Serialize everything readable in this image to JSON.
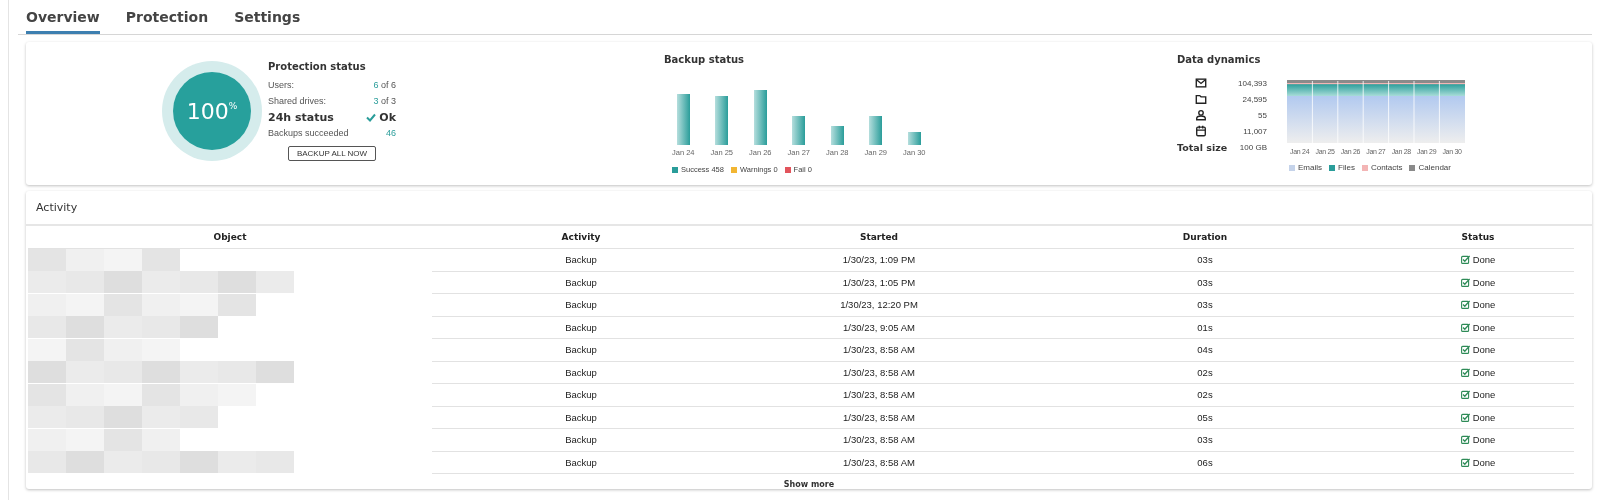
{
  "tabs": [
    {
      "label": "Overview",
      "selected": true
    },
    {
      "label": "Protection",
      "selected": false
    },
    {
      "label": "Settings",
      "selected": false
    }
  ],
  "protection": {
    "title": "Protection status",
    "percent": "100",
    "percent_sign": "%",
    "rows": [
      {
        "kind": "ratio",
        "label": "Users:",
        "value": "6",
        "suffix": "of 6"
      },
      {
        "kind": "ratio",
        "label": "Shared drives:",
        "value": "3",
        "suffix": "of 3"
      },
      {
        "kind": "status",
        "label": "24h status",
        "value": "Ok"
      },
      {
        "kind": "count",
        "label": "Backups succeeded",
        "value": "46"
      }
    ],
    "button": "BACKUP ALL NOW"
  },
  "backup_status": {
    "title": "Backup status",
    "x_labels": [
      "Jan 24",
      "Jan 25",
      "Jan 26",
      "Jan 27",
      "Jan 28",
      "Jan 29",
      "Jan 30"
    ],
    "legend": [
      {
        "label": "Success 458",
        "color": "#2a9d9a"
      },
      {
        "label": "Warnings 0",
        "color": "#f2b632"
      },
      {
        "label": "Fail 0",
        "color": "#e2545c"
      }
    ]
  },
  "data_dynamics": {
    "title": "Data dynamics",
    "counts": [
      {
        "kind": "email",
        "value": "104,393"
      },
      {
        "kind": "folder",
        "value": "24,595"
      },
      {
        "kind": "person",
        "value": "55"
      },
      {
        "kind": "calendar",
        "value": "11,007"
      }
    ],
    "total": {
      "label": "Total size",
      "value": "100 GB"
    },
    "x_labels": [
      "Jan 24",
      "Jan 25",
      "Jan 26",
      "Jan 27",
      "Jan 28",
      "Jan 29",
      "Jan 30"
    ],
    "legend": [
      {
        "label": "Emails",
        "color": "#c5d3ea"
      },
      {
        "label": "Files",
        "color": "#2a9d9a"
      },
      {
        "label": "Contacts",
        "color": "#f3b5b5"
      },
      {
        "label": "Calendar",
        "color": "#8a8a8a"
      }
    ]
  },
  "activity": {
    "title": "Activity",
    "columns": [
      "Object",
      "Activity",
      "Started",
      "Duration",
      "Status"
    ],
    "rows": [
      {
        "activity": "Backup",
        "started": "1/30/23, 1:09 PM",
        "duration": "03s",
        "status": "Done"
      },
      {
        "activity": "Backup",
        "started": "1/30/23, 1:05 PM",
        "duration": "03s",
        "status": "Done"
      },
      {
        "activity": "Backup",
        "started": "1/30/23, 12:20 PM",
        "duration": "03s",
        "status": "Done"
      },
      {
        "activity": "Backup",
        "started": "1/30/23, 9:05 AM",
        "duration": "01s",
        "status": "Done"
      },
      {
        "activity": "Backup",
        "started": "1/30/23, 8:58 AM",
        "duration": "04s",
        "status": "Done"
      },
      {
        "activity": "Backup",
        "started": "1/30/23, 8:58 AM",
        "duration": "02s",
        "status": "Done"
      },
      {
        "activity": "Backup",
        "started": "1/30/23, 8:58 AM",
        "duration": "02s",
        "status": "Done"
      },
      {
        "activity": "Backup",
        "started": "1/30/23, 8:58 AM",
        "duration": "05s",
        "status": "Done"
      },
      {
        "activity": "Backup",
        "started": "1/30/23, 8:58 AM",
        "duration": "03s",
        "status": "Done"
      },
      {
        "activity": "Backup",
        "started": "1/30/23, 8:58 AM",
        "duration": "06s",
        "status": "Done"
      }
    ],
    "show_more": "Show more"
  }
}
